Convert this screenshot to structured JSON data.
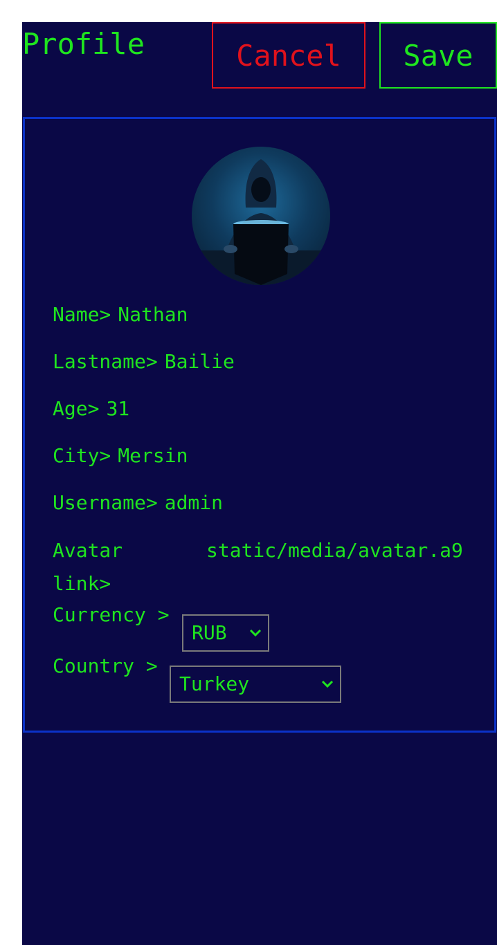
{
  "header": {
    "title": "Profile",
    "cancel_label": "Cancel",
    "save_label": "Save"
  },
  "profile": {
    "name_label": "Name>",
    "name_value": "Nathan",
    "lastname_label": "Lastname>",
    "lastname_value": "Bailie",
    "age_label": "Age>",
    "age_value": "31",
    "city_label": "City>",
    "city_value": "Mersin",
    "username_label": "Username>",
    "username_value": "admin",
    "avatar_label_line1": "Avatar",
    "avatar_label_line2": "link>",
    "avatar_value": "static/media/avatar.a9",
    "currency_label": "Currency >",
    "currency_value": "RUB",
    "country_label": "Country >",
    "country_value": "Turkey"
  },
  "colors": {
    "background": "#0a0846",
    "text": "#1fe51f",
    "cancel": "#e0121c",
    "save": "#1fe51f",
    "card_border": "#0b32c8",
    "select_border": "#7a7a7a"
  },
  "icons": {
    "select_chevron": "chevron-down-icon"
  }
}
